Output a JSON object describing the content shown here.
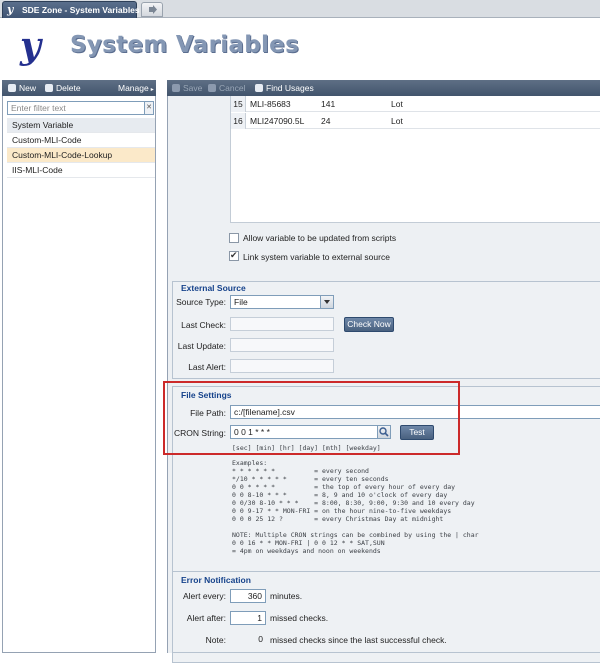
{
  "app": {
    "tab_title": "SDE Zone - System Variables",
    "page_title": "System Variables"
  },
  "left_toolbar": {
    "new_label": "New",
    "delete_label": "Delete",
    "manage_label": "Manage"
  },
  "filter": {
    "placeholder": "Enter filter text"
  },
  "variables": {
    "header": "System Variable",
    "items": [
      "Custom-MLI-Code",
      "Custom-MLI-Code-Lookup",
      "IIS-MLI-Code"
    ],
    "selected": "Custom-MLI-Code-Lookup"
  },
  "right_toolbar": {
    "save_label": "Save",
    "cancel_label": "Cancel",
    "find_usages_label": "Find Usages"
  },
  "grid": {
    "rows": [
      {
        "n": "15",
        "c1": "MLI-85683",
        "c2": "141",
        "c3": "Lot"
      },
      {
        "n": "16",
        "c1": "MLI247090.5L",
        "c2": "24",
        "c3": "Lot"
      }
    ]
  },
  "options": {
    "allow_scripts_label": "Allow variable to be updated from scripts",
    "allow_scripts_checked": false,
    "link_external_label": "Link system variable to external source",
    "link_external_checked": true
  },
  "external_source": {
    "legend": "External Source",
    "source_type_label": "Source Type:",
    "source_type_value": "File",
    "last_check_label": "Last Check:",
    "last_update_label": "Last Update:",
    "last_alert_label": "Last Alert:",
    "check_now_label": "Check Now"
  },
  "file_settings": {
    "legend": "File Settings",
    "file_path_label": "File Path:",
    "file_path_value": "c:/[filename].csv",
    "cron_label": "CRON String:",
    "cron_value": "0 0 1 * * *",
    "test_label": "Test",
    "cron_hint": "[sec] [min] [hr] [day] [mth] [weekday]",
    "examples": "Examples:\n* * * * * *          = every second\n*/10 * * * * *       = every ten seconds\n0 0 * * * *          = the top of every hour of every day\n0 0 8-10 * * *       = 8, 9 and 10 o'clock of every day\n0 0/30 8-10 * * *    = 8:00, 8:30, 9:00, 9:30 and 10 every day\n0 0 9-17 * * MON-FRI = on the hour nine-to-five weekdays\n0 0 0 25 12 ?        = every Christmas Day at midnight\n\nNOTE: Multiple CRON strings can be combined by using the | char\n0 0 16 * * MON-FRI | 0 0 12 * * SAT,SUN\n= 4pm on weekdays and noon on weekends"
  },
  "error_notification": {
    "legend": "Error Notification",
    "alert_every_label": "Alert every:",
    "alert_every_value": "360",
    "alert_every_suffix": "minutes.",
    "alert_after_label": "Alert after:",
    "alert_after_value": "1",
    "alert_after_suffix": "missed checks.",
    "note_label": "Note:",
    "note_value": "0",
    "note_suffix": "missed checks since the last successful check."
  }
}
